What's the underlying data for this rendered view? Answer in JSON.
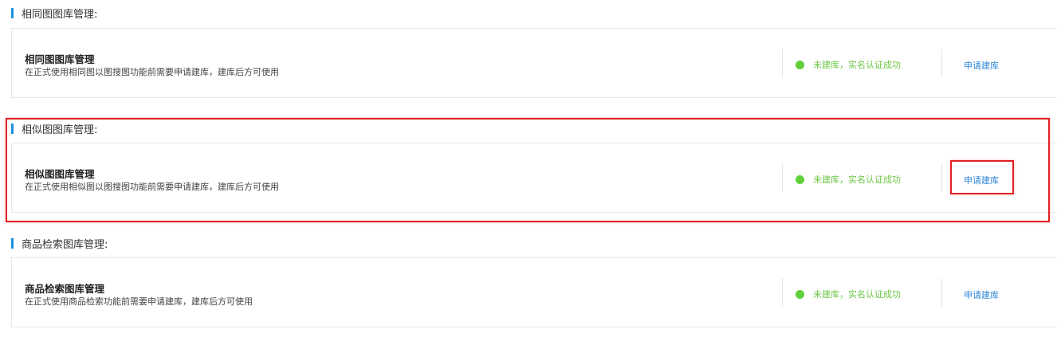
{
  "sections": [
    {
      "header": "相同图图库管理:",
      "card": {
        "title": "相同图图库管理",
        "description": "在正式使用相同图以图搜图功能前需要申请建库，建库后方可使用",
        "status": "未建库，实名认证成功",
        "action": "申请建库"
      }
    },
    {
      "header": "相似图图库管理:",
      "card": {
        "title": "相似图图库管理",
        "description": "在正式使用相似图以图搜图功能前需要申请建库，建库后方可使用",
        "status": "未建库，实名认证成功",
        "action": "申请建库"
      }
    },
    {
      "header": "商品检索图库管理:",
      "card": {
        "title": "商品检索图库管理",
        "description": "在正式使用商品检索功能前需要申请建库，建库后方可使用",
        "status": "未建库，实名认证成功",
        "action": "申请建库"
      }
    }
  ],
  "colors": {
    "accent_bar": "#1a90e0",
    "status_green": "#5fcf3a",
    "link_blue": "#2d86d6",
    "highlight_red": "#e02020"
  },
  "icons": {
    "status_indicator": "status-dot-icon"
  }
}
